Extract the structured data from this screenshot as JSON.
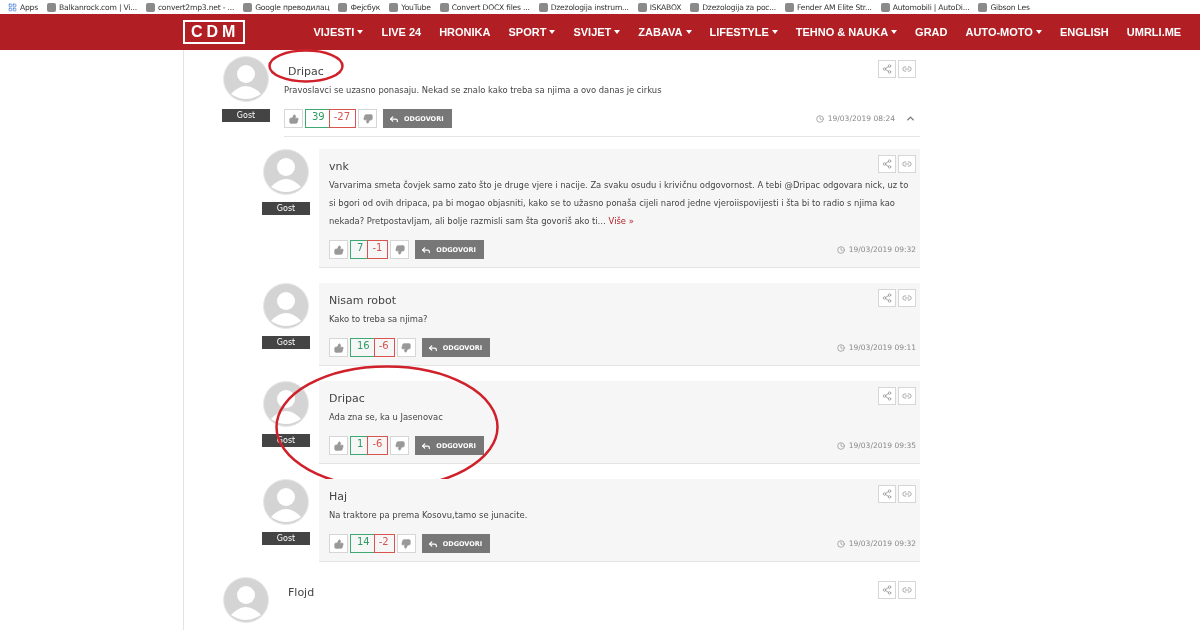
{
  "bookmarks": [
    {
      "label": "Apps",
      "kind": "apps"
    },
    {
      "label": "Balkanrock.com | Vi...",
      "kind": "site"
    },
    {
      "label": "convert2mp3.net - ...",
      "kind": "site"
    },
    {
      "label": "Google преводилац",
      "kind": "site"
    },
    {
      "label": "Фејсбук",
      "kind": "site"
    },
    {
      "label": "YouTube",
      "kind": "site"
    },
    {
      "label": "Convert DOCX files ...",
      "kind": "site"
    },
    {
      "label": "Dzezologija instrum...",
      "kind": "site"
    },
    {
      "label": "ISKABOX",
      "kind": "site"
    },
    {
      "label": "Dzezologija za poc...",
      "kind": "site"
    },
    {
      "label": "Fender AM Elite Str...",
      "kind": "site"
    },
    {
      "label": "Automobili | AutoDi...",
      "kind": "site"
    },
    {
      "label": "Gibson Les",
      "kind": "site"
    }
  ],
  "nav": {
    "logo": "CDM",
    "items": [
      {
        "label": "VIJESTI",
        "dropdown": true
      },
      {
        "label": "LIVE 24",
        "dropdown": false
      },
      {
        "label": "HRONIKA",
        "dropdown": false
      },
      {
        "label": "SPORT",
        "dropdown": true
      },
      {
        "label": "SVIJET",
        "dropdown": true
      },
      {
        "label": "ZABAVA",
        "dropdown": true
      },
      {
        "label": "LIFESTYLE",
        "dropdown": true
      },
      {
        "label": "TEHNO & NAUKA",
        "dropdown": true
      },
      {
        "label": "GRAD",
        "dropdown": false
      },
      {
        "label": "AUTO-MOTO",
        "dropdown": true
      },
      {
        "label": "ENGLISH",
        "dropdown": false
      },
      {
        "label": "UMRLI.ME",
        "dropdown": false
      }
    ]
  },
  "comments": [
    {
      "author": "Dripac",
      "circled": true,
      "badge": "Gost",
      "text": "Pravoslavci se uzasno ponasaju. Nekad se znalo kako treba sa njima a ovo danas je cirkus",
      "likes": "39",
      "dislikes": "-27",
      "reply": "ODGOVORI",
      "time": "19/03/2019 08:24",
      "expanded": true,
      "children": [
        {
          "author": "vnk",
          "circled": false,
          "badge": "Gost",
          "text": "Varvarima smeta čovjek samo zato što je druge vjere i nacije. Za svaku osudu i krivičnu odgovornost. A tebi @Dripac odgovara nick, uz to si bgori od ovih dripaca, pa bi mogao objasniti, kako se to užasno ponaša cijeli narod jedne vjeroiispovijesti i šta bi to radio s njima kao nekada? Pretpostavljam, ali bolje razmisli sam šta govoriš ako ti…",
          "more": "Više »",
          "likes": "7",
          "dislikes": "-1",
          "reply": "ODGOVORI",
          "time": "19/03/2019 09:32"
        },
        {
          "author": "Nisam robot",
          "circled": false,
          "badge": "Gost",
          "text": "Kako to treba sa njima?",
          "likes": "16",
          "dislikes": "-6",
          "reply": "ODGOVORI",
          "time": "19/03/2019 09:11"
        },
        {
          "author": "Dripac",
          "circled": true,
          "badge": "Gost",
          "text": "Ada zna se, ka u Jasenovac",
          "likes": "1",
          "dislikes": "-6",
          "reply": "ODGOVORI",
          "time": "19/03/2019 09:35"
        },
        {
          "author": "Haj",
          "circled": false,
          "badge": "Gost",
          "text": "Na traktore pa prema Kosovu,tamo se junacite.",
          "likes": "14",
          "dislikes": "-2",
          "reply": "ODGOVORI",
          "time": "19/03/2019 09:32"
        }
      ]
    },
    {
      "author": "Flojd",
      "circled": false
    }
  ]
}
